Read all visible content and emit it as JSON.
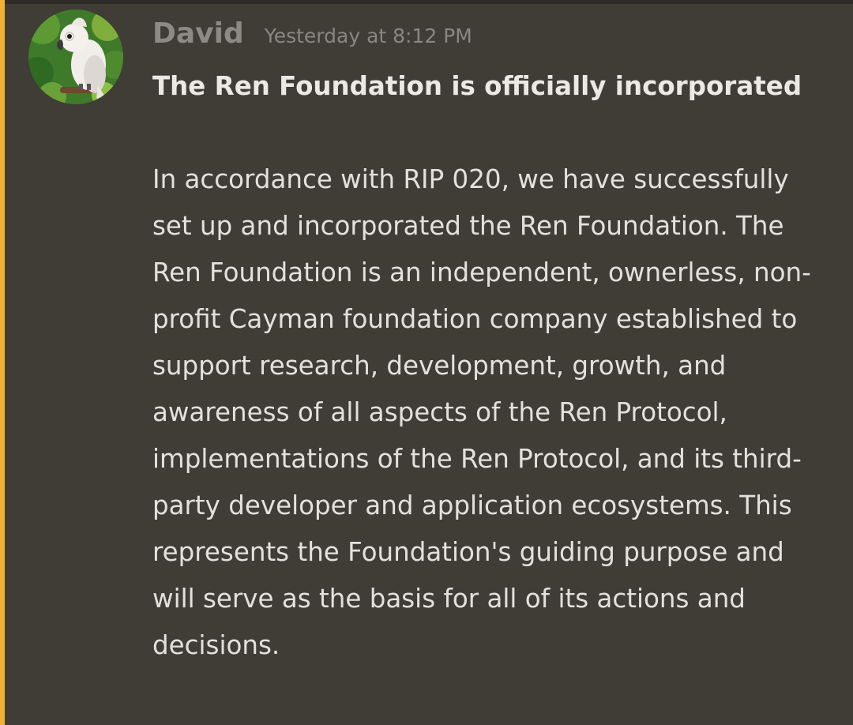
{
  "message": {
    "author": "David",
    "timestamp": "Yesterday at 8:12 PM",
    "title": "The Ren Foundation is officially incorporated",
    "body": "In accordance with RIP 020, we have successfully set up and incorporated the Ren Foundation. The Ren Foundation is an independent, ownerless, non-profit Cayman foundation company established to support research, development, growth, and awareness of all aspects of the Ren Protocol, implementations of the Ren Protocol, and its third-party developer and application ecosystems. This represents the Foundation's guiding purpose and will serve as the basis for all of its actions and decisions."
  },
  "avatar": {
    "icon": "cockatoo-avatar-icon"
  },
  "colors": {
    "background": "#403c36",
    "mention_bar": "#f0b232",
    "username": "#8d8a85",
    "text": "#e4e1dc"
  }
}
